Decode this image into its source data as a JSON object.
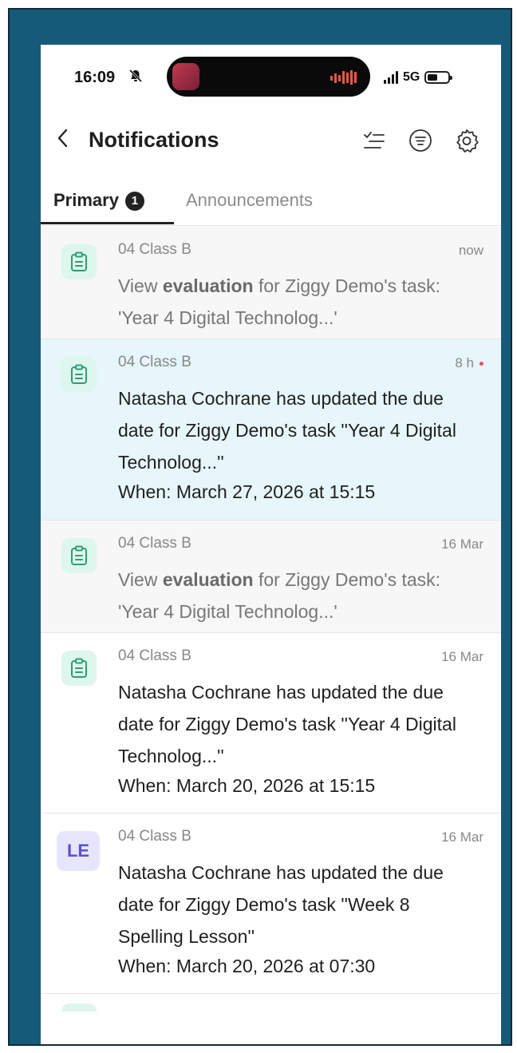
{
  "status_bar": {
    "time": "16:09",
    "network": "5G"
  },
  "header": {
    "title": "Notifications"
  },
  "tabs": {
    "primary_label": "Primary",
    "primary_badge": "1",
    "announcements_label": "Announcements"
  },
  "notifications": [
    {
      "class": "04 Class B",
      "time": "now",
      "pre": "View ",
      "bold": "evaluation",
      "post": " for Ziggy Demo's task: 'Year 4 Digital Technolog...'"
    },
    {
      "class": "04 Class B",
      "time": "8 h",
      "message": "Natasha Cochrane has updated the due date for Ziggy Demo's task ''Year 4 Digital Technolog...''",
      "when": "When: March 27, 2026 at 15:15"
    },
    {
      "class": "04 Class B",
      "time": "16 Mar",
      "pre": "View ",
      "bold": "evaluation",
      "post": " for Ziggy Demo's task: 'Year 4 Digital Technolog...'"
    },
    {
      "class": "04 Class B",
      "time": "16 Mar",
      "message": "Natasha Cochrane has updated the due date for Ziggy Demo's task ''Year 4 Digital Technolog...''",
      "when": "When: March 20, 2026 at 15:15"
    },
    {
      "class": "04 Class B",
      "time": "16 Mar",
      "avatar_text": "LE",
      "message": "Natasha Cochrane has updated the due date for Ziggy Demo's task ''Week 8 Spelling Lesson''",
      "when": "When: March 20, 2026 at 07:30"
    }
  ]
}
